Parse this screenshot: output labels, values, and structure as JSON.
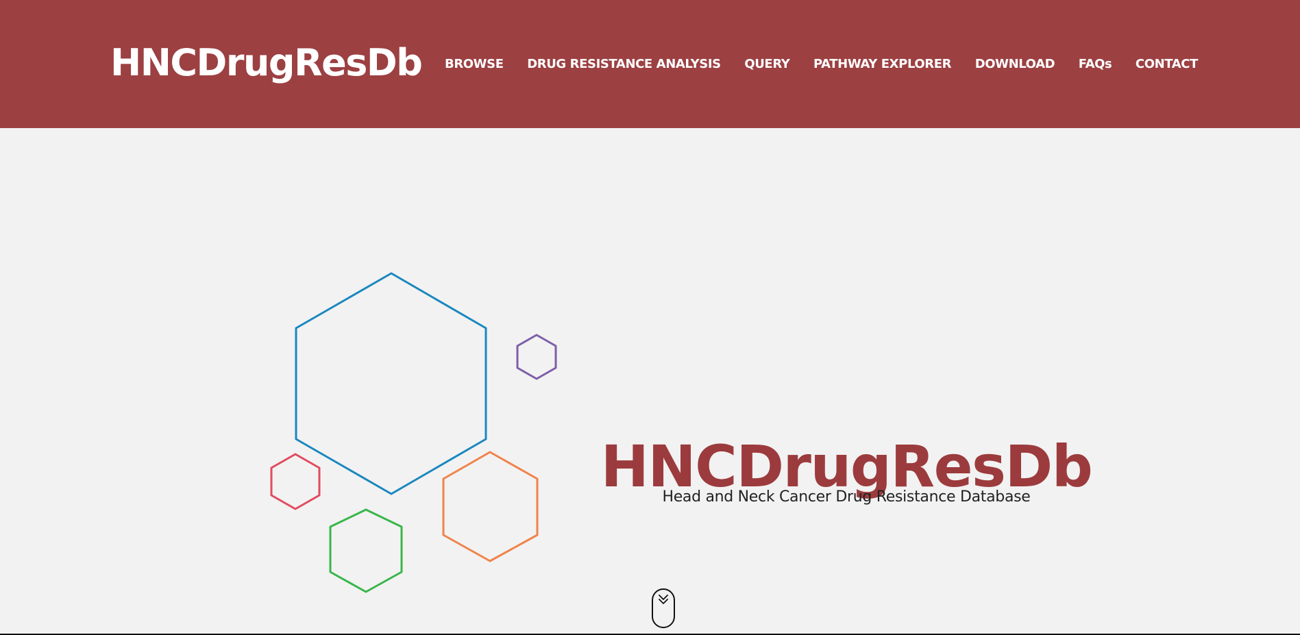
{
  "header": {
    "brand": "HNCDrugResDb",
    "nav": [
      {
        "label": "BROWSE"
      },
      {
        "label": "DRUG RESISTANCE ANALYSIS"
      },
      {
        "label": "QUERY"
      },
      {
        "label": "PATHWAY EXPLORER"
      },
      {
        "label": "DOWNLOAD"
      },
      {
        "label": "FAQs"
      },
      {
        "label": "CONTACT"
      }
    ]
  },
  "hero": {
    "title": "HNCDrugResDb",
    "subtitle": "Head and Neck Cancer Drug Resistance Database",
    "scroll_icon": "double-chevron-down-icon"
  },
  "colors": {
    "header_bg": "#9c4042",
    "page_bg": "#f2f2f2",
    "title": "#9c3b3d",
    "hex_blue": "#1a87bf",
    "hex_purple": "#7d5fa8",
    "hex_red": "#e14b5e",
    "hex_orange": "#f0834a",
    "hex_green": "#3ab54a"
  }
}
